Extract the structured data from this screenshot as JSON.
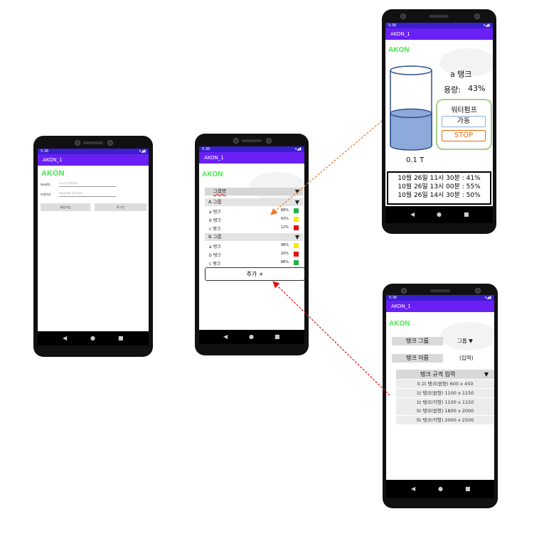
{
  "app": {
    "title": "AKON_1",
    "logo": "AKON",
    "status_time": "5:36",
    "status_icons": "▾◢▮"
  },
  "nav": {
    "back": "◀",
    "home": "●",
    "recent": "■"
  },
  "login": {
    "id_label": "Health...",
    "id_placeholder": "2020년 회원정보...",
    "pw_label": "비밀번호",
    "pw_placeholder": "비밀번호를 입력하세요",
    "signup_button": "회원가입",
    "login_button": "로그인"
  },
  "list": {
    "group_select": "그룹명",
    "groups": [
      {
        "name": "A 그룹",
        "tanks": [
          {
            "name": "a 탱크",
            "pct": "88%",
            "color": "#22b14c"
          },
          {
            "name": "b 탱크",
            "pct": "43%",
            "color": "#f5e80c"
          },
          {
            "name": "c 탱크",
            "pct": "12%",
            "color": "#e01010"
          }
        ]
      },
      {
        "name": "B 그룹",
        "tanks": [
          {
            "name": "a 탱크",
            "pct": "48%",
            "color": "#f5e80c"
          },
          {
            "name": "b 탱크",
            "pct": "20%",
            "color": "#e01010"
          },
          {
            "name": "c 탱크",
            "pct": "88%",
            "color": "#22b14c"
          }
        ]
      }
    ],
    "add_button": "추가 +"
  },
  "detail": {
    "tank_name": "a 탱크",
    "capacity_label": "용량:",
    "capacity_value": "43%",
    "level": 0.43,
    "tank_size": "0.1 T",
    "pump_title": "워터펌프",
    "pump_on": "가동",
    "pump_stop": "STOP",
    "history": [
      "10월 26일 11시 30분 : 41%",
      "10월 26일 13시 00분 : 55%",
      "10월 26일 14시 30분 : 50%"
    ]
  },
  "form": {
    "group_label": "탱크 그룹",
    "group_value": "그룹 ▼",
    "name_label": "탱크 이름",
    "name_value": "(입력)",
    "spec_label": "탱크 규격 입력",
    "spec_arrow": "▼",
    "specs": [
      "0.1t 탱크(원형) 600 x 450",
      "1t 탱크(원형) 1100 x 1150",
      "1t 탱크(각형) 1100 x 1150",
      "5t 탱크(원형) 1800 x 2000",
      "5t 탱크(각형) 2000 x 2500"
    ]
  },
  "colors": {
    "status_bar": "#3a1fcf",
    "app_bar": "#6a1ff5",
    "logo": "#44e64a",
    "tank_water": "#8eaadb",
    "tank_outline": "#2f4f8f",
    "pump_border": "#a8d08d",
    "stop_border": "#e36c09",
    "arrow_orange": "#e87a2a",
    "arrow_red": "#e01010"
  }
}
